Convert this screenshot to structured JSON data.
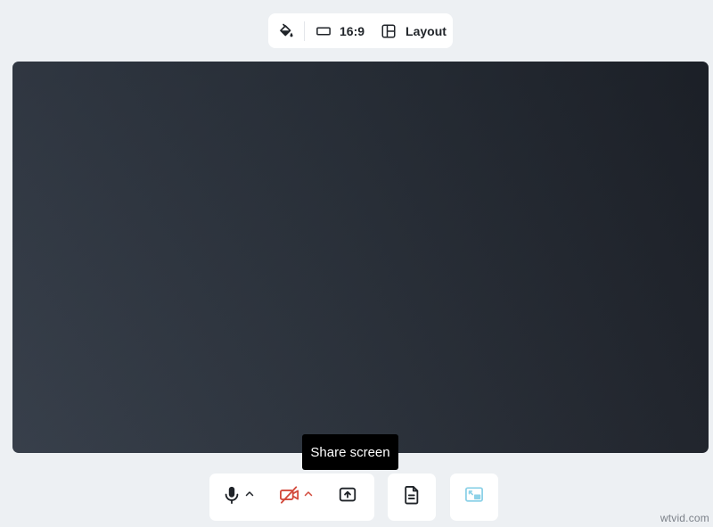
{
  "toolbar": {
    "fill_icon": "paint-bucket-icon",
    "ratio_icon": "rectangle-icon",
    "ratio_label": "16:9",
    "layout_icon": "layout-icon",
    "layout_label": "Layout"
  },
  "tooltip": {
    "text": "Share screen"
  },
  "controls": {
    "mic_icon": "microphone-icon",
    "camera_icon": "camera-off-icon",
    "share_icon": "screen-share-icon",
    "notes_icon": "document-icon",
    "pip_icon": "picture-in-picture-icon",
    "caret_icon": "chevron-up-icon"
  },
  "colors": {
    "page_background": "#edf0f3",
    "camera_off": "#d34a3c",
    "pip_disabled": "#8ed2e8",
    "tooltip_background": "#000000"
  },
  "watermark": "wtvid.com"
}
